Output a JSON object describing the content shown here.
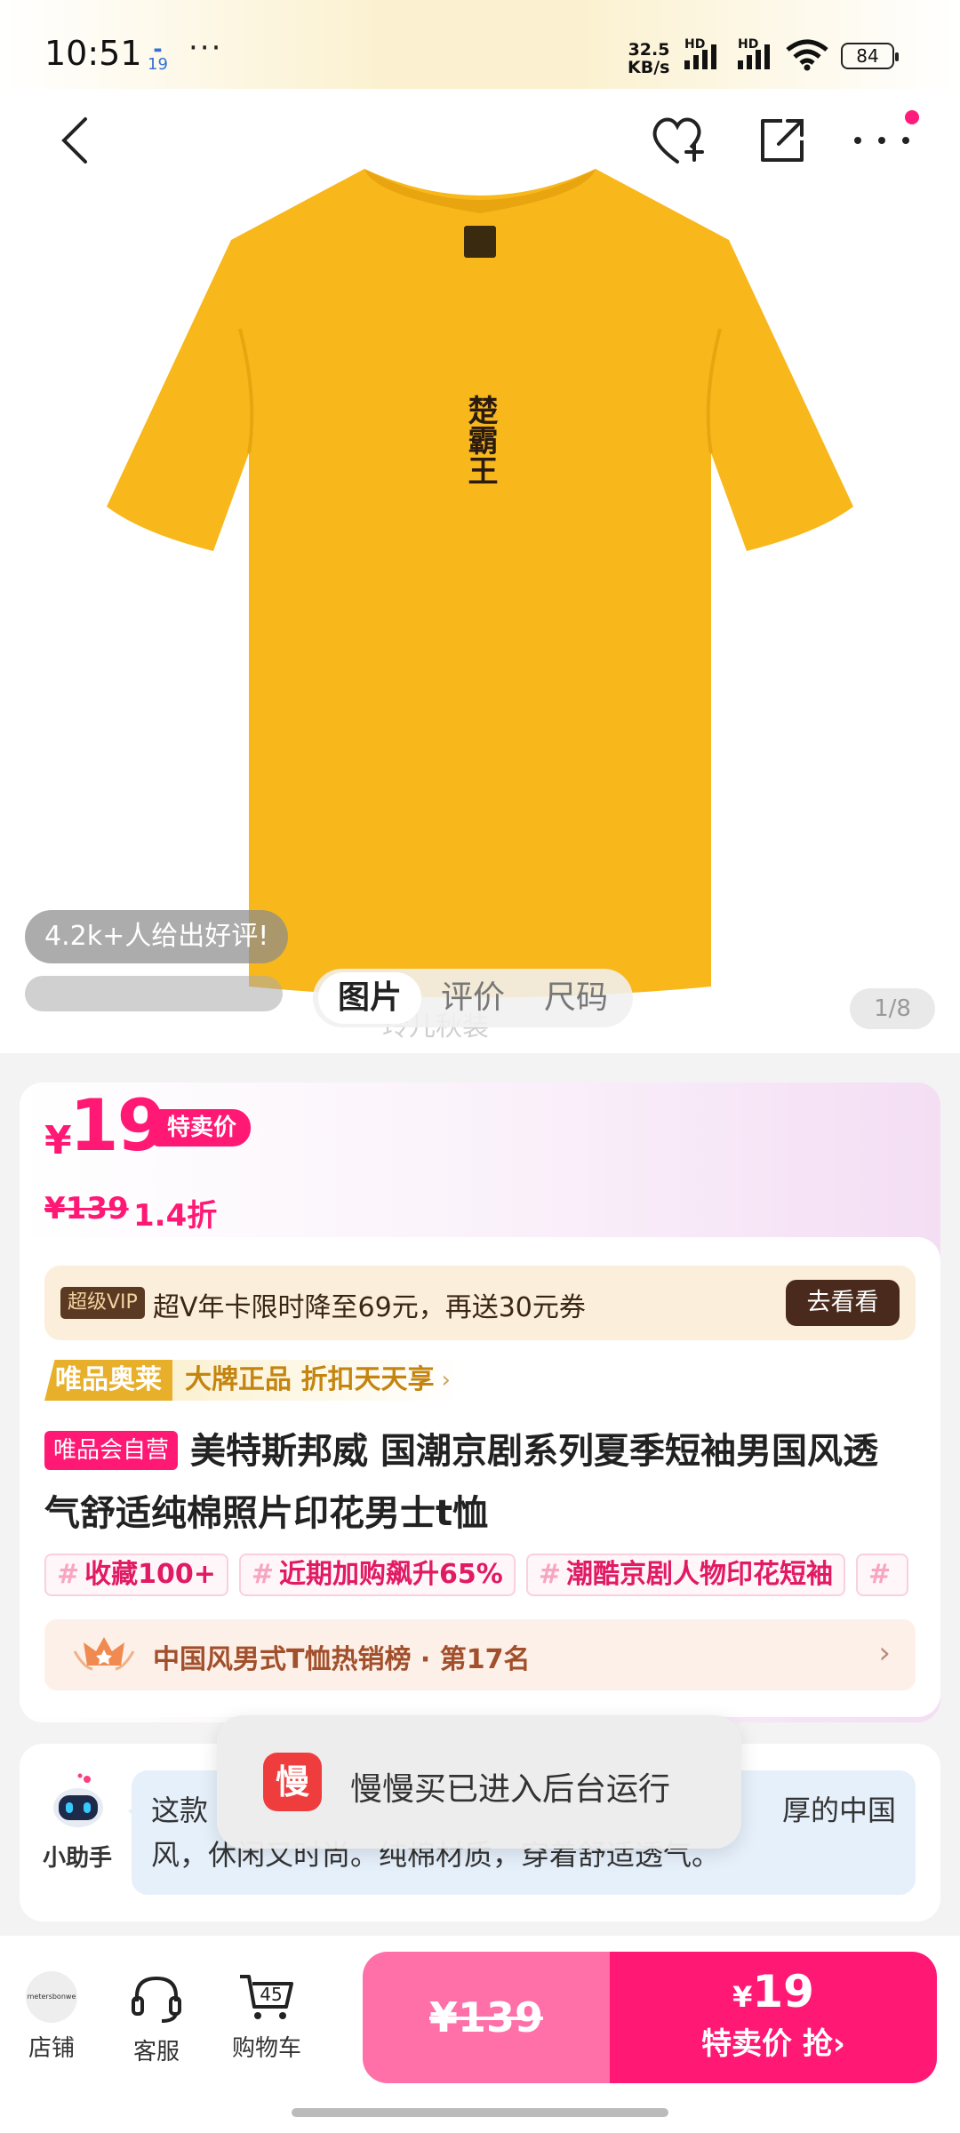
{
  "status_bar": {
    "time": "10:51",
    "calendar_day": "19",
    "more": "···",
    "speed_value": "32.5",
    "speed_unit": "KB/s",
    "hd1": "HD",
    "hd2": "HD",
    "battery": "84"
  },
  "hero": {
    "shirt_print": "楚霸王",
    "review_pill": "4.2k+人给出好评!",
    "tabs": [
      {
        "label": "图片"
      },
      {
        "label": "评价"
      },
      {
        "label": "尺码"
      }
    ],
    "watermark": "玲儿秋装",
    "pager": "1/8"
  },
  "price": {
    "currency": "¥",
    "value": "19",
    "tag": "特卖价",
    "original": "¥139",
    "discount": "1.4折"
  },
  "vip": {
    "tag": "超级VIP",
    "text": "超V年卡限时降至69元，再送30元券",
    "button": "去看看"
  },
  "outlet": {
    "brand": "唯品奥莱",
    "slogan": "大牌正品 折扣天天享",
    "chevron": "›"
  },
  "product": {
    "self_badge": "唯品会自营",
    "title": "美特斯邦威 国潮京剧系列夏季短袖男国风透气舒适纯棉照片印花男士t恤"
  },
  "tags": [
    {
      "hash": "#",
      "text": "收藏100+"
    },
    {
      "hash": "#",
      "text": "近期加购飙升65%"
    },
    {
      "hash": "#",
      "text": "潮酷京剧人物印花短袖"
    },
    {
      "hash": "#",
      "text": ""
    }
  ],
  "rank": {
    "text": "中国风男式T恤热销榜 · 第17名",
    "chevron": "›"
  },
  "assistant": {
    "label": "小助手",
    "line1_left": "这款",
    "line1_right": "厚的中国",
    "line2": "风，休闲又时尚。纯棉材质，穿着舒适透气。"
  },
  "toast": {
    "icon_text": "慢",
    "message": "慢慢买已进入后台运行"
  },
  "bottom_bar": {
    "store": {
      "label": "店铺",
      "logo_text": "metersbonwe"
    },
    "service": {
      "label": "客服"
    },
    "cart": {
      "label": "购物车",
      "count": "45"
    },
    "original_price": "¥139",
    "buy_currency": "¥",
    "buy_price": "19",
    "buy_label": "特卖价 抢",
    "buy_chevron": "›"
  },
  "colors": {
    "accent": "#ff1874",
    "accent_light": "#ff6fa8",
    "shirt": "#f8b81c",
    "vip_bg": "#fbeedb",
    "bubble_bg": "#e6f0fb"
  }
}
